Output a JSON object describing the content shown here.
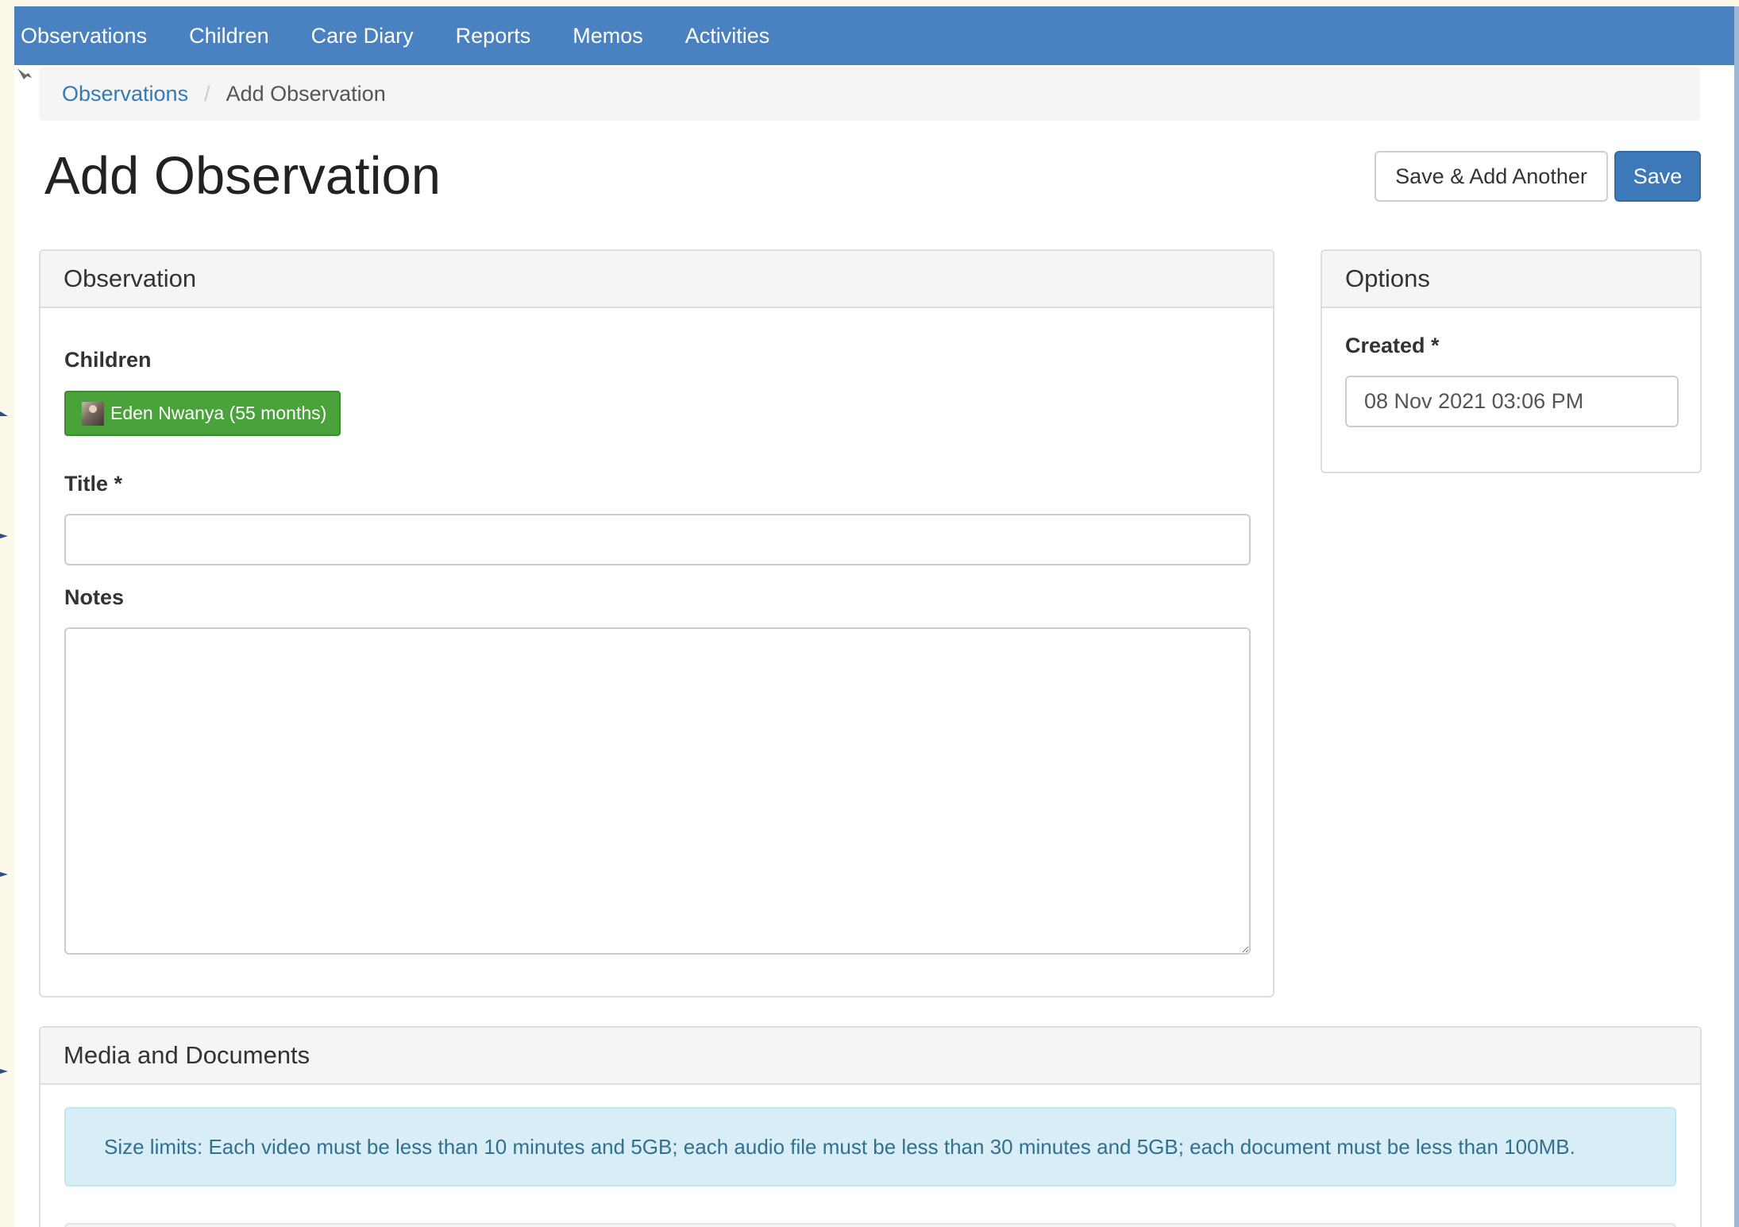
{
  "nav": {
    "items": [
      "Observations",
      "Children",
      "Care Diary",
      "Reports",
      "Memos",
      "Activities"
    ]
  },
  "breadcrumb": {
    "parent": "Observations",
    "separator": "/",
    "current": "Add Observation"
  },
  "page": {
    "title": "Add Observation"
  },
  "actions": {
    "save_add_another": "Save & Add Another",
    "save": "Save"
  },
  "observation_panel": {
    "heading": "Observation",
    "children_label": "Children",
    "child_tag": "Eden Nwanya (55 months)",
    "title_label": "Title *",
    "title_value": "",
    "notes_label": "Notes",
    "notes_value": ""
  },
  "options_panel": {
    "heading": "Options",
    "created_label": "Created *",
    "created_value": "08 Nov 2021 03:06 PM"
  },
  "media_panel": {
    "heading": "Media and Documents",
    "size_limits": "Size limits: Each video must be less than 10 minutes and 5GB; each audio file must be less than 30 minutes and 5GB; each document must be less than 100MB."
  },
  "colors": {
    "navbar": "#4a82c1",
    "primary": "#3d79b9",
    "child_tag": "#4aa23b",
    "info_bg": "#d9edf7",
    "info_text": "#31708f"
  }
}
